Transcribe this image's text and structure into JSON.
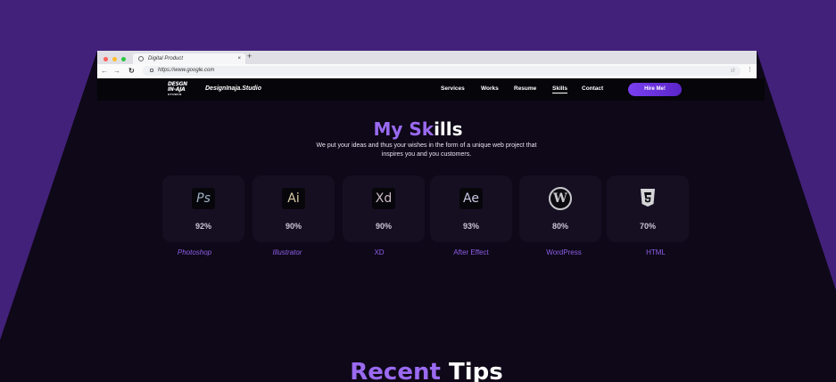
{
  "browser": {
    "tab_title": "Digital Product",
    "tab_close": "×",
    "new_tab": "+",
    "url": "https://www.google.com",
    "back": "←",
    "forward": "→",
    "reload": "↻",
    "star": "☆",
    "menu": "⋮",
    "dot_colors": [
      "#ff5f57",
      "#febc2e",
      "#28c840"
    ]
  },
  "nav": {
    "logo_lines": [
      "DESGN",
      "IN-AJA",
      "STUDIO"
    ],
    "brand": "DesignInaja.Studio",
    "items": [
      "Services",
      "Works",
      "Resume",
      "Skills",
      "Contact"
    ],
    "active": "Skills",
    "cta": "Hire Me!"
  },
  "skills": {
    "title_accent": "My Sk",
    "title_rest": "ills",
    "subtitle_line1": "We put your ideas and thus your wishes in the form of a unique web project that",
    "subtitle_line2": "inspires you and you customers.",
    "items": [
      {
        "icon": "Ps",
        "percent": "92%",
        "name": "Photoshop",
        "color": "#2fa3f7"
      },
      {
        "icon": "Ai",
        "percent": "90%",
        "name": "Illustrator",
        "color": "#ff9a00"
      },
      {
        "icon": "Xd",
        "percent": "90%",
        "name": "XD",
        "color": "#ff61f6"
      },
      {
        "icon": "Ae",
        "percent": "93%",
        "name": "After Effect",
        "color": "#9999ff"
      },
      {
        "icon": "wordpress-icon",
        "percent": "80%",
        "name": "WordPress",
        "color": "#c8c8cc"
      },
      {
        "icon": "html5-icon",
        "percent": "70%",
        "name": "HTML",
        "color": "#c8c8cc"
      }
    ]
  },
  "recent": {
    "accent": "Recent",
    "rest": " Tips"
  },
  "colors": {
    "background": "#42217a",
    "page": "#0e0818",
    "accent": "#8e5ee8"
  }
}
